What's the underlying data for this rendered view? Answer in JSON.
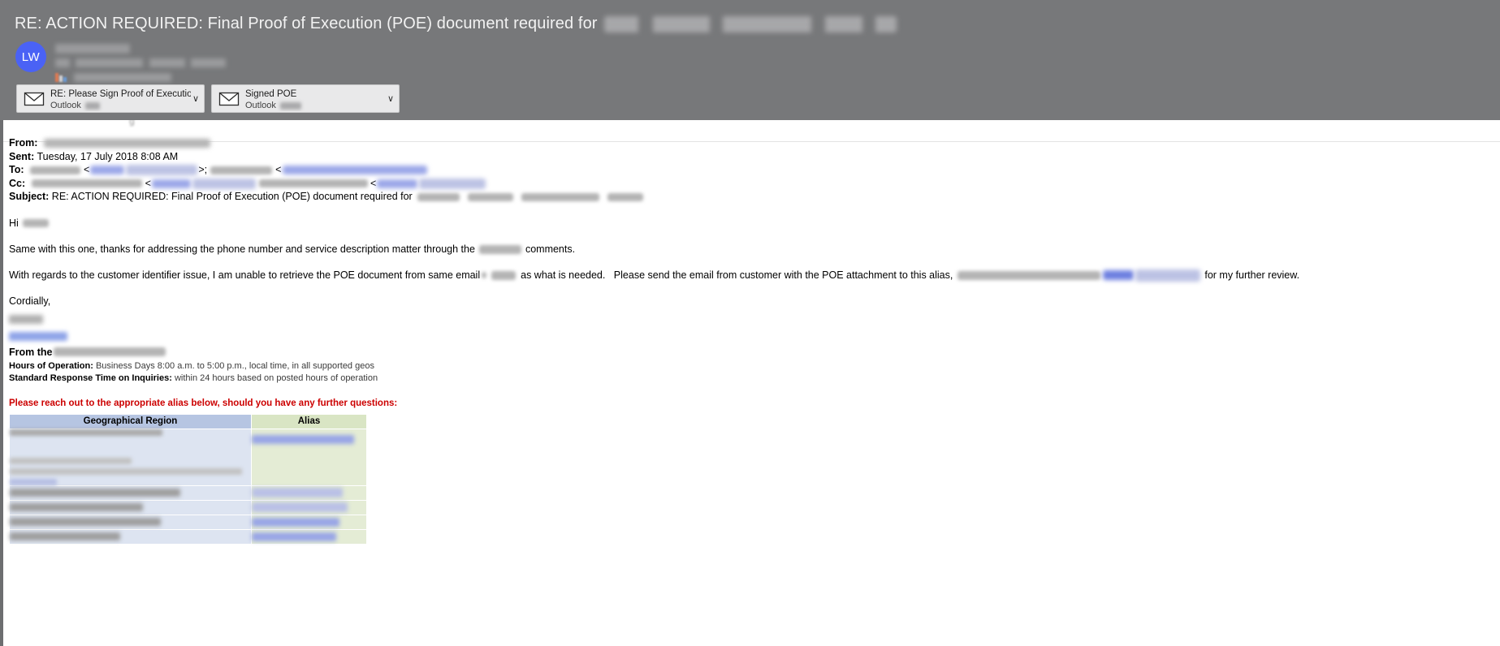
{
  "window": {
    "subject_visible": "RE: ACTION REQUIRED: Final Proof of Execution (POE) document required for",
    "avatar_initials": "LW"
  },
  "attachments": [
    {
      "title": "RE: Please Sign Proof of Execution Form",
      "source": "Outlook",
      "icon": "envelope-icon",
      "chevron": "∨"
    },
    {
      "title": "Signed POE",
      "source": "Outlook",
      "icon": "envelope-icon",
      "chevron": "∨"
    }
  ],
  "headers": {
    "from_label": "From:",
    "sent_label": "Sent:",
    "sent_value": "Tuesday, 17 July 2018 8:08 AM",
    "to_label": "To:",
    "cc_label": "Cc:",
    "subject_label": "Subject:",
    "subject_value": "RE: ACTION REQUIRED: Final Proof of Execution (POE) document required for",
    "angle_open": "<",
    "angle_close_semi": ">;",
    "angle_close": ">"
  },
  "body": {
    "greeting": "Hi",
    "para1_before": "Same with this one, thanks for addressing the phone number and service description matter through the",
    "para1_after": "comments.",
    "para2_a": "With regards to the customer identifier issue, I am unable to retrieve the POE document from same email",
    "para2_b": "as what is needed.",
    "para2_c": "Please send the email from customer with the POE attachment to this alias,",
    "para2_d": "for my further review.",
    "closing": "Cordially,"
  },
  "signature": {
    "from_the_label": "From the",
    "hours_label": "Hours of Operation:",
    "hours_value": "Business Days 8:00 a.m. to 5:00 p.m., local time, in all supported geos",
    "response_label": "Standard Response Time on Inquiries:",
    "response_value": "within 24 hours based on posted hours of operation"
  },
  "alias_table": {
    "notice": "Please reach out to the appropriate alias below, should you have any further questions:",
    "columns": [
      "Geographical Region",
      "Alias"
    ],
    "rows": [
      {
        "region": "[redacted]",
        "alias": "[redacted]",
        "tall": true
      },
      {
        "region": "[redacted]",
        "alias": "[redacted]",
        "tall": false
      },
      {
        "region": "[redacted]",
        "alias": "[redacted]",
        "tall": false
      },
      {
        "region": "[redacted]",
        "alias": "[redacted]",
        "tall": false
      },
      {
        "region": "[redacted]",
        "alias": "[redacted]",
        "tall": false
      }
    ]
  },
  "colors": {
    "chrome_bg": "#77787a",
    "avatar_bg": "#4a62f5",
    "notice_red": "#cc0000",
    "header_region": "#b6c5e2",
    "header_alias": "#d9e5c4",
    "cell_region": "#dde4f1",
    "cell_alias": "#e4ecd5"
  }
}
